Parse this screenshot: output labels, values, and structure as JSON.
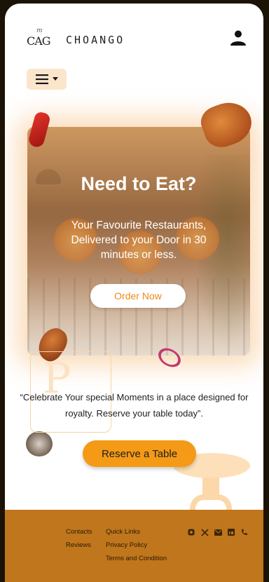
{
  "header": {
    "logo_small": "m",
    "logo_mark": "CAG",
    "brand": "CHOANGO"
  },
  "hero": {
    "title": "Need to Eat?",
    "subtitle": "Your Favourite Restaurants, Delivered to your Door in 30 minutes or less.",
    "cta": "Order Now"
  },
  "quote": {
    "letter": "P",
    "text": "“Celebrate Your special Moments in a place designed for royalty. Reserve your  table today”."
  },
  "reserve": {
    "label": "Reserve a Table"
  },
  "footer": {
    "col1": [
      "Contacts",
      "Reviews"
    ],
    "col2": [
      "Quick Links",
      "Privacy Policy",
      "Terms and Condition"
    ],
    "social_icons": [
      "instagram-icon",
      "x-icon",
      "mail-icon",
      "linkedin-icon",
      "phone-icon"
    ]
  },
  "colors": {
    "accent": "#f49a16",
    "footer_bg": "#c0761c",
    "menu_bg": "#fbe6cc",
    "cta_text": "#f08a17"
  }
}
